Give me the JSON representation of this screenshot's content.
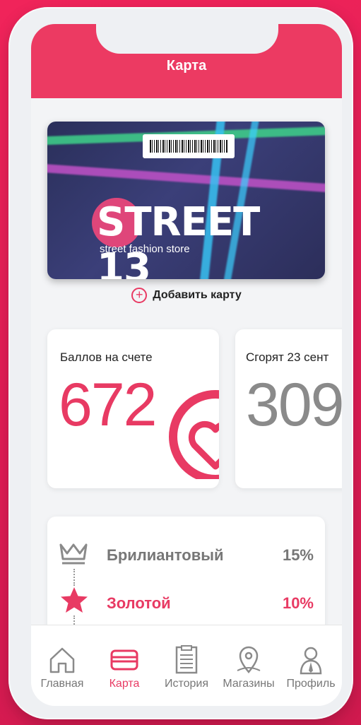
{
  "header": {
    "title": "Карта"
  },
  "card": {
    "brand": "STREET 13",
    "tagline": "street fashion store",
    "add_label": "Добавить карту"
  },
  "points": {
    "balance_label": "Баллов на счете",
    "balance_value": "672",
    "expire_label": "Сгорят 23 сент",
    "expire_value": "309"
  },
  "levels": [
    {
      "name": "Брилиантовый",
      "percent": "15%",
      "color": "#777777"
    },
    {
      "name": "Золотой",
      "percent": "10%",
      "color": "#e83a63"
    }
  ],
  "tabbar": {
    "items": [
      {
        "label": "Главная",
        "icon": "home-icon"
      },
      {
        "label": "Карта",
        "icon": "card-icon",
        "active": true
      },
      {
        "label": "История",
        "icon": "history-icon"
      },
      {
        "label": "Магазины",
        "icon": "map-pin-icon"
      },
      {
        "label": "Профиль",
        "icon": "profile-icon"
      }
    ]
  },
  "colors": {
    "accent": "#e83a63",
    "header": "#ec3a62",
    "muted": "#8a8a8a"
  }
}
